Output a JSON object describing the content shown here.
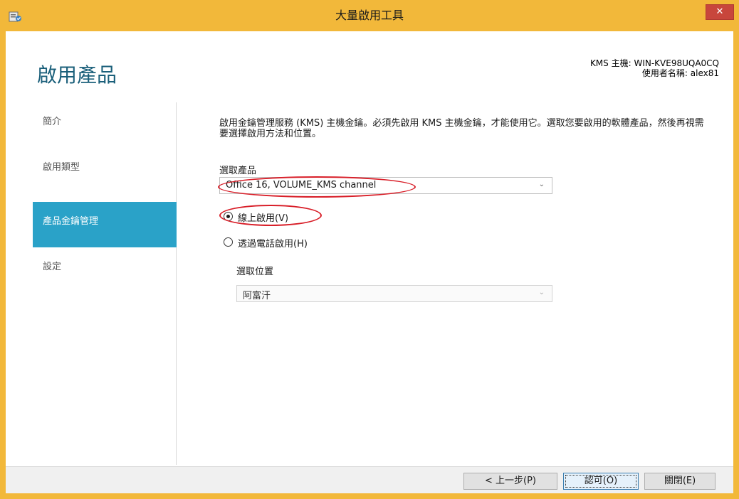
{
  "window": {
    "title": "大量啟用工具",
    "close_glyph": "✕"
  },
  "header": {
    "heading": "啟用產品",
    "kms_host": "KMS 主機: WIN-KVE98UQA0CQ",
    "username": "使用者名稱: alex81"
  },
  "sidebar": {
    "items": [
      {
        "label": "簡介",
        "active": false
      },
      {
        "label": "啟用類型",
        "active": false
      },
      {
        "label": "產品金鑰管理",
        "active": true
      },
      {
        "label": "設定",
        "active": false
      }
    ]
  },
  "main": {
    "description": "啟用金鑰管理服務 (KMS) 主機金鑰。必須先啟用 KMS 主機金鑰，才能使用它。選取您要啟用的軟體產品，然後再視需要選擇啟用方法和位置。",
    "product_label": "選取產品",
    "product_value": "Office 16, VOLUME_KMS channel",
    "radio_online": "線上啟用(V)",
    "radio_phone": "透過電話啟用(H)",
    "radio_selected": "online",
    "location_label": "選取位置",
    "location_value": "阿富汗",
    "chevron_glyph": "⌄"
  },
  "footer": {
    "back_label": "< 上一步(P)",
    "ok_label": "認可(O)",
    "close_label": "關閉(E)"
  },
  "colors": {
    "title_bar": "#f2b83a",
    "accent": "#2aa2c8",
    "heading": "#1a5f7a",
    "annotation": "#d81e28",
    "close_button": "#c8463c"
  }
}
